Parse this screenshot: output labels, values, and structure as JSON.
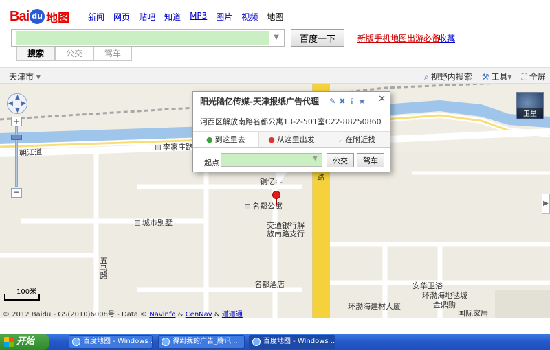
{
  "header": {
    "logo_text_bai": "Bai",
    "logo_text_du": "du",
    "logo_text_ditu": "地图",
    "nav": [
      "新闻",
      "网页",
      "贴吧",
      "知道",
      "MP3",
      "图片",
      "视频",
      "地图"
    ],
    "search_placeholder": "",
    "search_button": "百度一下",
    "newbie_link": "新版手机地图出游必备",
    "separator": "|",
    "favorites_link": "收藏",
    "mode_tabs": [
      "搜索",
      "公交",
      "驾车"
    ]
  },
  "toolbar": {
    "city": "天津市",
    "city_arrow": "▾",
    "tools": [
      "视野内搜索",
      "工具",
      "全屏"
    ],
    "tools_arrow": "▾"
  },
  "map": {
    "labels": {
      "road_fujiang": "朝江道",
      "poi_lijiazhuang": "李家庄路",
      "poi_yizhen": "铜亿丰",
      "poi_mingdu": "名都公寓",
      "poi_chengshi": "城市别墅",
      "poi_jiaotong": "交通银行解",
      "poi_jiaotong2": "放南路支行",
      "road_wuma": "五马路",
      "poi_mingdujiu": "名都酒店",
      "poi_anhua": "安华卫浴",
      "poi_huanbo": "环渤海地毯城",
      "poi_huanbo2": "环渤海建材大厦",
      "poi_jinyu": "金鼎购",
      "poi_guoji": "国际家居",
      "road_right": "路"
    },
    "satellite": "卫星",
    "scale": "100米",
    "copyright_prefix": "© 2012 Baidu - GS(2010)6008号 - Data ©",
    "copyright_link1": "Navinfo",
    "copyright_amp": "&",
    "copyright_link2": "CenNav",
    "copyright_amp2": "&",
    "copyright_link3": "道道通"
  },
  "info_window": {
    "title": "阳光陆亿传媒-天津报纸广告代理",
    "address": "河西区解放南路名都公寓13-2-501室C22-88250860",
    "tabs": [
      "到这里去",
      "从这里出发",
      "在附近找"
    ],
    "start_label": "起点",
    "bus_button": "公交",
    "drive_button": "驾车",
    "close": "✕"
  },
  "taskbar": {
    "start": "开始",
    "tasks": [
      "百度地图 - Windows ...",
      "得到我的广告_腾讯...",
      "百度地图 - Windows ..."
    ]
  },
  "colors": {
    "logo_red": "#e10601",
    "link_blue": "#0000cc",
    "river": "#9fc6ea",
    "main_road": "#f5d23b"
  }
}
